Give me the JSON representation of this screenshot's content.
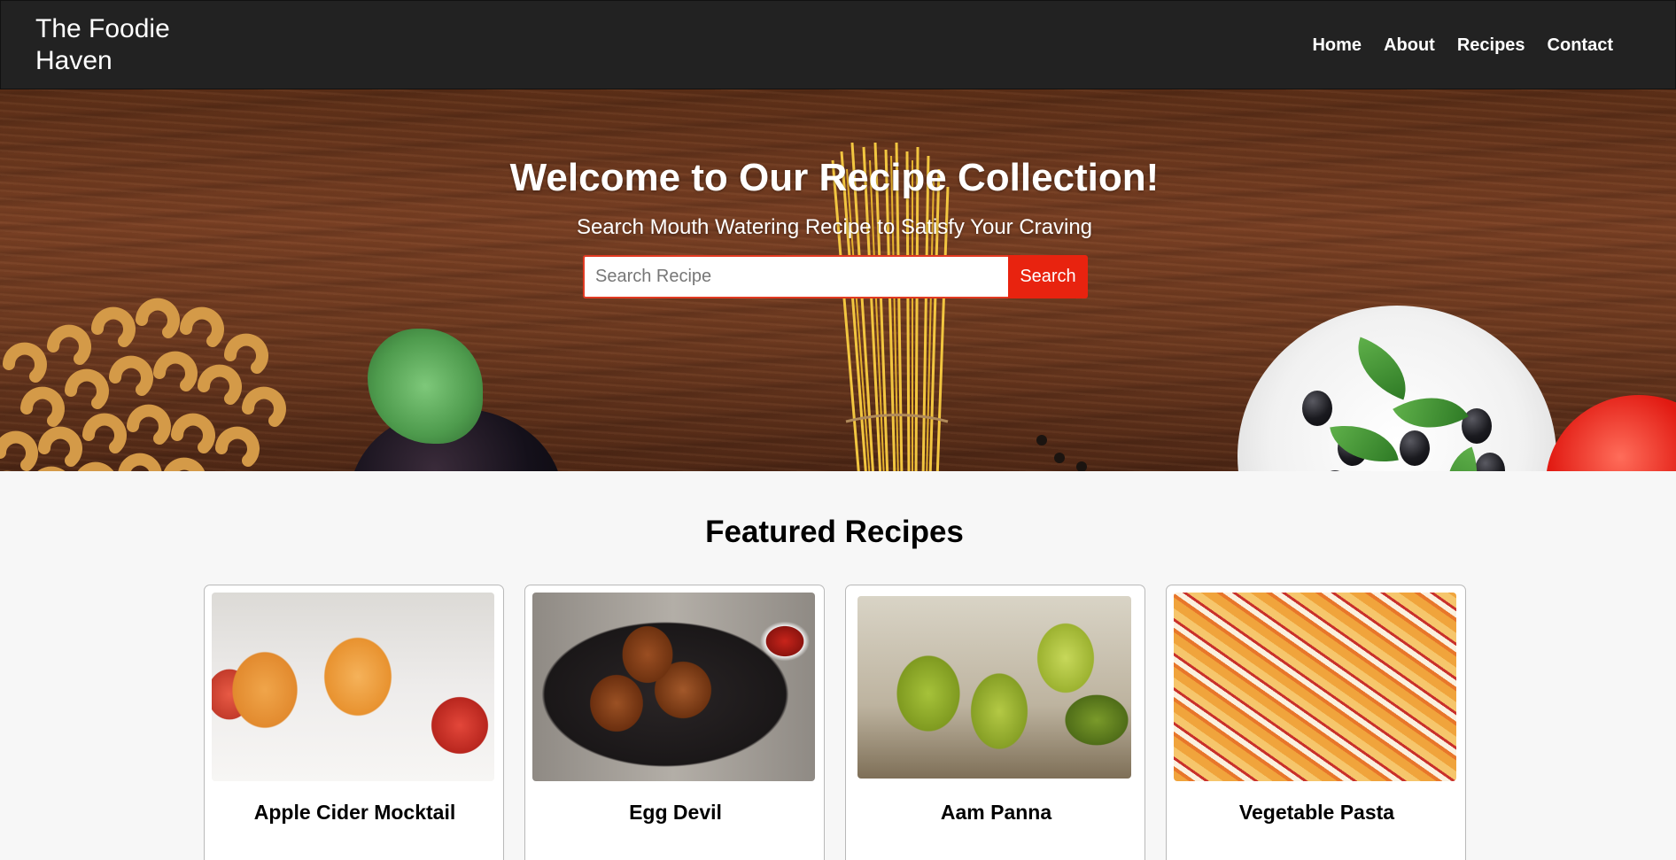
{
  "nav": {
    "brand": "The Foodie Haven",
    "links": [
      {
        "label": "Home"
      },
      {
        "label": "About"
      },
      {
        "label": "Recipes"
      },
      {
        "label": "Contact"
      }
    ]
  },
  "hero": {
    "title": "Welcome to Our Recipe Collection!",
    "subtitle": "Search Mouth Watering Recipe to Satisfy Your Craving",
    "search": {
      "placeholder": "Search Recipe",
      "value": "",
      "button_label": "Search"
    }
  },
  "featured": {
    "heading": "Featured Recipes",
    "recipes": [
      {
        "title": "Apple Cider Mocktail"
      },
      {
        "title": "Egg Devil"
      },
      {
        "title": "Aam Panna"
      },
      {
        "title": "Vegetable Pasta"
      }
    ]
  },
  "colors": {
    "nav_bg": "#222222",
    "accent": "#e8230f",
    "page_bg": "#f7f7f7"
  }
}
